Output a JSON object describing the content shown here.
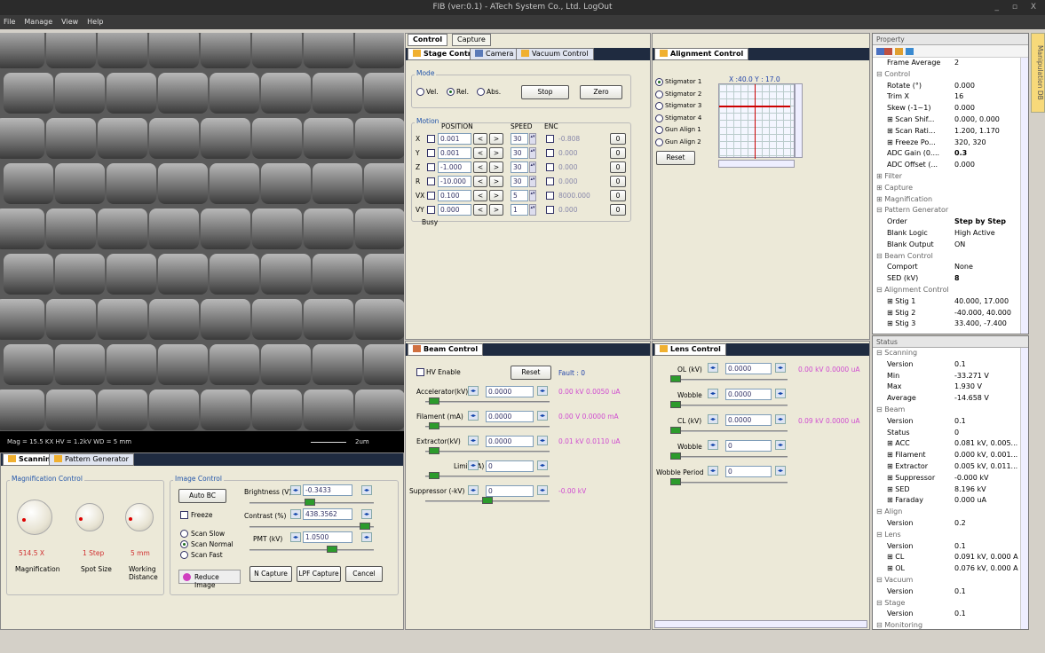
{
  "window": {
    "title": "FIB (ver:0.1) - ATech System Co., Ltd.  LogOut",
    "controls": "_ ▫ X"
  },
  "menu": [
    "File",
    "Manage",
    "View",
    "Help"
  ],
  "image": {
    "info": "Mag = 15.5 KX    HV = 1.2kV    WD = 5 mm",
    "scale": "2um"
  },
  "bottomleft": {
    "tabs": [
      "Scanning",
      "Pattern Generator"
    ],
    "mag_title": "Magnification Control",
    "knobs": [
      {
        "value": "514.5 X",
        "label": "Magnification"
      },
      {
        "value": "1 Step",
        "label": "Spot Size"
      },
      {
        "value": "5 mm",
        "label": "Working Distance"
      }
    ],
    "img_title": "Image Control",
    "autobc": "Auto BC",
    "freeze": "Freeze",
    "scan": [
      "Scan Slow",
      "Scan Normal",
      "Scan Fast"
    ],
    "reduce": "Reduce Image",
    "brightness_lbl": "Brightness (V)",
    "brightness": "-0.3433",
    "contrast_lbl": "Contrast (%)",
    "contrast": "438.3562",
    "pmt_lbl": "PMT (kV)",
    "pmt": "1.0500",
    "ncap": "N Capture",
    "lpf": "LPF Capture",
    "cancel": "Cancel"
  },
  "stage": {
    "toptabs": [
      "Control",
      "Capture"
    ],
    "tabs": [
      "Stage Control",
      "Camera",
      "Vacuum Control"
    ],
    "mode_title": "Mode",
    "modes": [
      "Vel.",
      "Rel.",
      "Abs."
    ],
    "stop": "Stop",
    "zero": "Zero",
    "motion_title": "Motion",
    "hdr": [
      "POSITION",
      "SPEED",
      "ENC"
    ],
    "axes": [
      {
        "n": "X",
        "pos": "0.001",
        "spd": "30",
        "enc": "-0.808"
      },
      {
        "n": "Y",
        "pos": "0.001",
        "spd": "30",
        "enc": "0.000"
      },
      {
        "n": "Z",
        "pos": "-1.000",
        "spd": "30",
        "enc": "0.000"
      },
      {
        "n": "R",
        "pos": "-10.000",
        "spd": "30",
        "enc": "0.000"
      },
      {
        "n": "VX",
        "pos": "0.100",
        "spd": "5",
        "enc": "8000.000"
      },
      {
        "n": "VY",
        "pos": "0.000",
        "spd": "1",
        "enc": "0.000"
      }
    ],
    "zbtn": "0",
    "busy": "Busy"
  },
  "align": {
    "tab": "Alignment Control",
    "items": [
      "Stigmator 1",
      "Stigmator 2",
      "Stigmator 3",
      "Stigmator 4",
      "Gun Align 1",
      "Gun Align 2"
    ],
    "coords": "X :40.0 Y : 17.0",
    "reset": "Reset"
  },
  "beam": {
    "tab": "Beam Control",
    "hv": "HV Enable",
    "reset": "Reset",
    "fault": "Fault : 0",
    "rows": [
      {
        "l": "Accelerator(kV)",
        "v": "0.0000",
        "r": "0.00 kV  0.0050 uA"
      },
      {
        "l": "Filament (mA)",
        "v": "0.0000",
        "r": "0.00 V  0.0000 mA"
      },
      {
        "l": "Extractor(kV)",
        "v": "0.0000",
        "r": "0.01 kV  0.0110 uA"
      },
      {
        "l": "Limit(uA)",
        "v": "0",
        "r": ""
      },
      {
        "l": "Suppressor (-kV)",
        "v": "0",
        "r": "-0.00 kV"
      }
    ]
  },
  "lens": {
    "tab": "Lens Control",
    "rows": [
      {
        "l": "OL (kV)",
        "v": "0.0000",
        "r": "0.00 kV  0.0000 uA"
      },
      {
        "l": "Wobble",
        "v": "0.0000",
        "r": ""
      },
      {
        "l": "CL (kV)",
        "v": "0.0000",
        "r": "0.09 kV  0.0000 uA"
      },
      {
        "l": "Wobble",
        "v": "0",
        "r": ""
      },
      {
        "l": "Wobble Period",
        "v": "0",
        "r": ""
      }
    ]
  },
  "property": {
    "title": "Property",
    "rows": [
      {
        "k": "Frame Average",
        "v": "2",
        "t": "i"
      },
      {
        "k": "⊟ Control",
        "v": "",
        "t": "c"
      },
      {
        "k": "Rotate (°)",
        "v": "0.000",
        "t": "i"
      },
      {
        "k": "Trim X",
        "v": "16",
        "t": "i"
      },
      {
        "k": "Skew (-1~1)",
        "v": "0.000",
        "t": "i"
      },
      {
        "k": "⊞ Scan Shif...",
        "v": "0.000, 0.000",
        "t": "i"
      },
      {
        "k": "⊞ Scan Rati...",
        "v": "1.200, 1.170",
        "t": "i"
      },
      {
        "k": "⊞ Freeze Po...",
        "v": "320, 320",
        "t": "i"
      },
      {
        "k": "ADC Gain (0....",
        "v": "0.3",
        "t": "b"
      },
      {
        "k": "ADC Offset (...",
        "v": "0.000",
        "t": "i"
      },
      {
        "k": "⊞ Filter",
        "v": "",
        "t": "c"
      },
      {
        "k": "⊞ Capture",
        "v": "",
        "t": "c"
      },
      {
        "k": "⊞ Magnification",
        "v": "",
        "t": "c"
      },
      {
        "k": "⊟ Pattern Generator",
        "v": "",
        "t": "c"
      },
      {
        "k": "Order",
        "v": "Step by Step",
        "t": "b"
      },
      {
        "k": "Blank Logic",
        "v": "High Active",
        "t": "i"
      },
      {
        "k": "Blank Output",
        "v": "ON",
        "t": "i"
      },
      {
        "k": "⊟ Beam Control",
        "v": "",
        "t": "c"
      },
      {
        "k": "Comport",
        "v": "None",
        "t": "i"
      },
      {
        "k": "SED (kV)",
        "v": "8",
        "t": "b"
      },
      {
        "k": "⊟ Alignment Control",
        "v": "",
        "t": "c"
      },
      {
        "k": "⊞ Stig 1",
        "v": "40.000, 17.000",
        "t": "i"
      },
      {
        "k": "⊞ Stig 2",
        "v": "-40.000, 40.000",
        "t": "i"
      },
      {
        "k": "⊞ Stig 3",
        "v": "33.400, -7.400",
        "t": "i"
      }
    ]
  },
  "status": {
    "title": "Status",
    "rows": [
      {
        "k": "⊟ Scanning",
        "v": "",
        "t": "c"
      },
      {
        "k": "Version",
        "v": "0.1",
        "t": "i"
      },
      {
        "k": "Min",
        "v": "-33.271 V",
        "t": "i"
      },
      {
        "k": "Max",
        "v": "1.930 V",
        "t": "i"
      },
      {
        "k": "Average",
        "v": "-14.658 V",
        "t": "i"
      },
      {
        "k": "⊟ Beam",
        "v": "",
        "t": "c"
      },
      {
        "k": "Version",
        "v": "0.1",
        "t": "i"
      },
      {
        "k": "Status",
        "v": "0",
        "t": "i"
      },
      {
        "k": "⊞ ACC",
        "v": "0.081 kV, 0.005...",
        "t": "i"
      },
      {
        "k": "⊞ Filament",
        "v": "0.000 kV, 0.001...",
        "t": "i"
      },
      {
        "k": "⊞ Extractor",
        "v": "0.005 kV, 0.011...",
        "t": "i"
      },
      {
        "k": "⊞ Suppressor",
        "v": "-0.000 kV",
        "t": "i"
      },
      {
        "k": "⊞ SED",
        "v": "8.196 kV",
        "t": "i"
      },
      {
        "k": "⊞ Faraday",
        "v": "0.000 uA",
        "t": "i"
      },
      {
        "k": "⊟ Align",
        "v": "",
        "t": "c"
      },
      {
        "k": "Version",
        "v": "0.2",
        "t": "i"
      },
      {
        "k": "⊟ Lens",
        "v": "",
        "t": "c"
      },
      {
        "k": "Version",
        "v": "0.1",
        "t": "i"
      },
      {
        "k": "⊞ CL",
        "v": "0.091 kV, 0.000 A",
        "t": "i"
      },
      {
        "k": "⊞ OL",
        "v": "0.076 kV, 0.000 A",
        "t": "i"
      },
      {
        "k": "⊟ Vacuum",
        "v": "",
        "t": "c"
      },
      {
        "k": "Version",
        "v": "0.1",
        "t": "i"
      },
      {
        "k": "⊟ Stage",
        "v": "",
        "t": "c"
      },
      {
        "k": "Version",
        "v": "0.1",
        "t": "i"
      },
      {
        "k": "⊟ Monitoring",
        "v": "",
        "t": "c"
      }
    ]
  },
  "sidetab": "Manipulation DB"
}
